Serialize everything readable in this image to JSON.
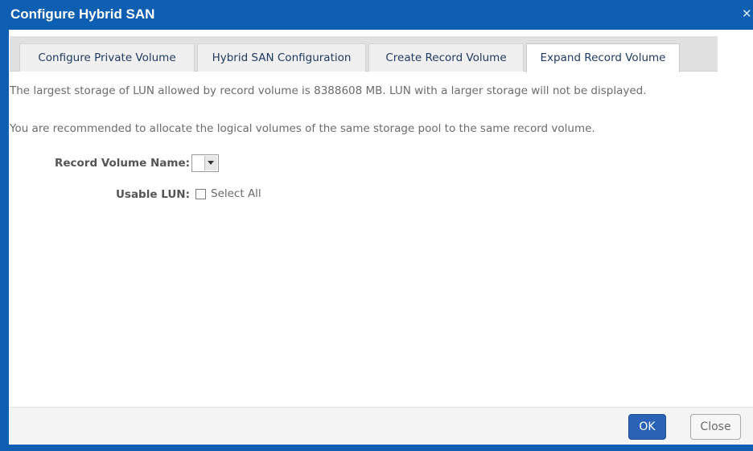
{
  "dialog": {
    "title": "Configure Hybrid SAN",
    "close_glyph": "✕"
  },
  "tabs": [
    {
      "label": "Configure Private Volume",
      "active": false
    },
    {
      "label": "Hybrid SAN Configuration",
      "active": false
    },
    {
      "label": "Create Record Volume",
      "active": false
    },
    {
      "label": "Expand Record Volume",
      "active": true
    }
  ],
  "content": {
    "info_line_1": "The largest storage of LUN allowed by record volume is 8388608 MB. LUN with a larger storage will not be displayed.",
    "info_line_2": "You are recommended to allocate the logical volumes of the same storage pool to the same record volume.",
    "record_volume_name_label": "Record Volume Name:",
    "record_volume_name_value": "",
    "usable_lun_label": "Usable LUN:",
    "select_all_label": "Select All",
    "select_all_checked": false
  },
  "buttons": {
    "ok_label": "OK",
    "close_label": "Close"
  },
  "colors": {
    "title_bar": "#0e5fb1",
    "ok_button": "#2a63b5",
    "tab_text": "#1f3b63"
  }
}
